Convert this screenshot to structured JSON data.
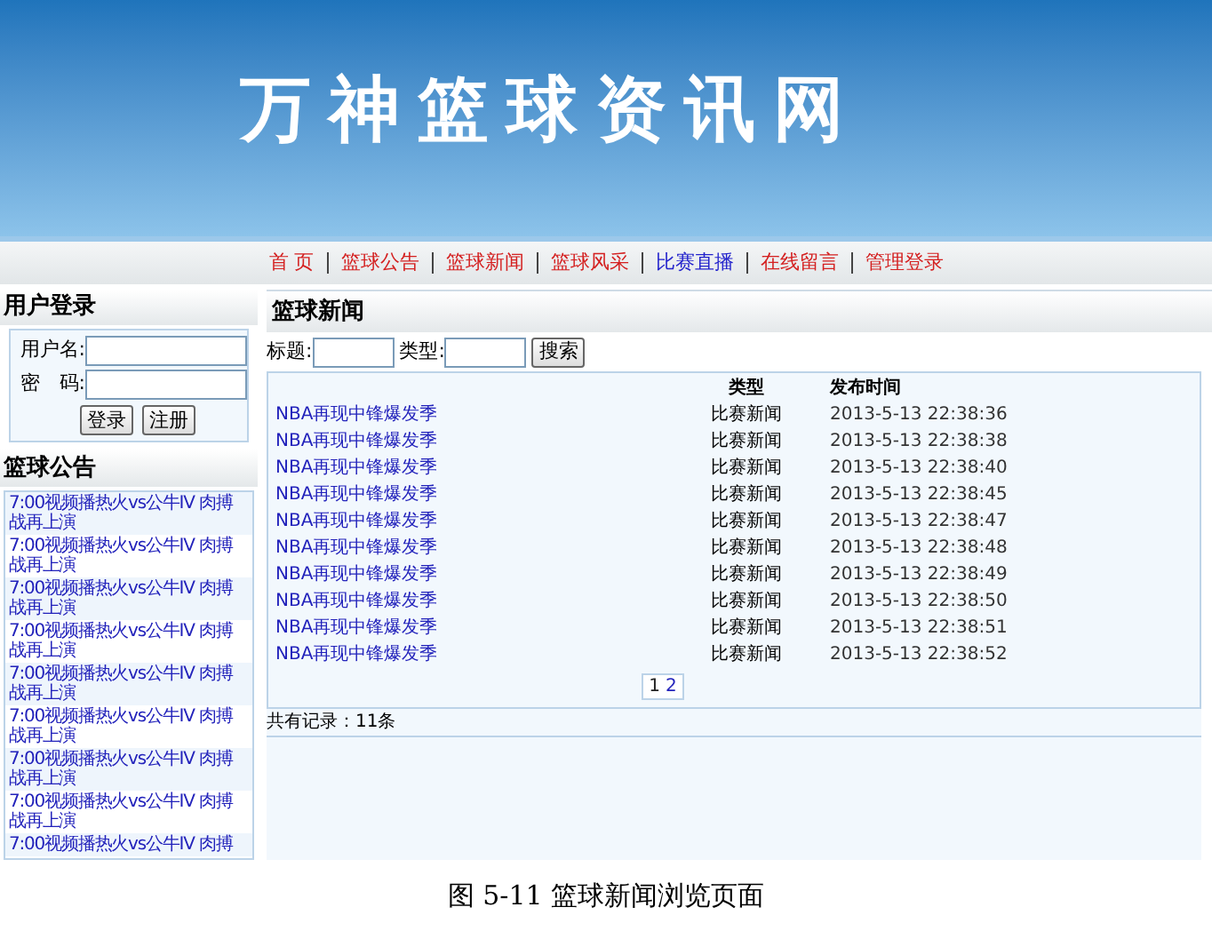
{
  "site_title": "万神篮球资讯网",
  "nav": [
    {
      "label": "首 页",
      "selected": false
    },
    {
      "label": "篮球公告",
      "selected": false
    },
    {
      "label": "篮球新闻",
      "selected": false
    },
    {
      "label": "篮球风采",
      "selected": false
    },
    {
      "label": "比赛直播",
      "selected": true
    },
    {
      "label": "在线留言",
      "selected": false
    },
    {
      "label": "管理登录",
      "selected": false
    }
  ],
  "login": {
    "title": "用户登录",
    "fields": [
      {
        "label": "用户名:"
      },
      {
        "label": "密　码:"
      }
    ],
    "buttons": [
      "登录",
      "注册"
    ]
  },
  "notices": {
    "title": "篮球公告",
    "items": [
      "7:00视频播热火vs公牛IV 肉搏战再上演",
      "7:00视频播热火vs公牛IV 肉搏战再上演",
      "7:00视频播热火vs公牛IV 肉搏战再上演",
      "7:00视频播热火vs公牛IV 肉搏战再上演",
      "7:00视频播热火vs公牛IV 肉搏战再上演",
      "7:00视频播热火vs公牛IV 肉搏战再上演",
      "7:00视频播热火vs公牛IV 肉搏战再上演",
      "7:00视频播热火vs公牛IV 肉搏战再上演",
      "7:00视频播热火vs公牛IV 肉搏"
    ]
  },
  "news": {
    "title": "篮球新闻",
    "search": {
      "fields": [
        {
          "label": "标题:"
        },
        {
          "label": "类型:"
        }
      ],
      "button": "搜索"
    },
    "table": {
      "columns": [
        "类型",
        "发布时间"
      ],
      "rows": [
        {
          "title": "NBA再现中锋爆发季",
          "type": "比赛新闻",
          "time": "2013-5-13 22:38:36"
        },
        {
          "title": "NBA再现中锋爆发季",
          "type": "比赛新闻",
          "time": "2013-5-13 22:38:38"
        },
        {
          "title": "NBA再现中锋爆发季",
          "type": "比赛新闻",
          "time": "2013-5-13 22:38:40"
        },
        {
          "title": "NBA再现中锋爆发季",
          "type": "比赛新闻",
          "time": "2013-5-13 22:38:45"
        },
        {
          "title": "NBA再现中锋爆发季",
          "type": "比赛新闻",
          "time": "2013-5-13 22:38:47"
        },
        {
          "title": "NBA再现中锋爆发季",
          "type": "比赛新闻",
          "time": "2013-5-13 22:38:48"
        },
        {
          "title": "NBA再现中锋爆发季",
          "type": "比赛新闻",
          "time": "2013-5-13 22:38:49"
        },
        {
          "title": "NBA再现中锋爆发季",
          "type": "比赛新闻",
          "time": "2013-5-13 22:38:50"
        },
        {
          "title": "NBA再现中锋爆发季",
          "type": "比赛新闻",
          "time": "2013-5-13 22:38:51"
        },
        {
          "title": "NBA再现中锋爆发季",
          "type": "比赛新闻",
          "time": "2013-5-13 22:38:52"
        }
      ]
    },
    "pagination": [
      {
        "label": "1",
        "selected": true
      },
      {
        "label": "2",
        "selected": false
      }
    ],
    "total": "共有记录：11条"
  },
  "caption": "图 5-11 篮球新闻浏览页面"
}
